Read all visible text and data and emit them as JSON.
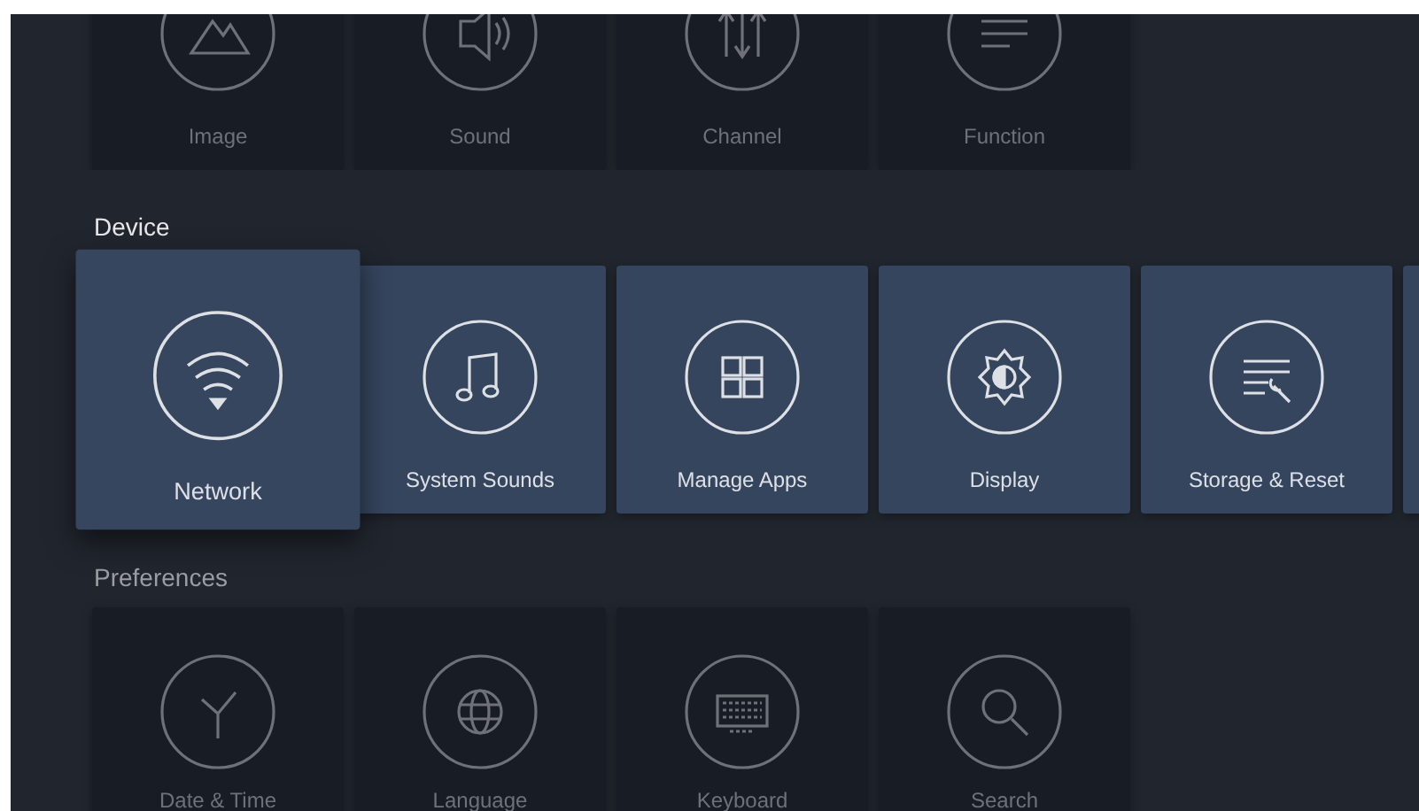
{
  "sections": [
    {
      "active": false,
      "items": [
        {
          "label": "Image",
          "kind": "image",
          "selected": false
        },
        {
          "label": "Sound",
          "kind": "sound",
          "selected": false
        },
        {
          "label": "Channel",
          "kind": "channel",
          "selected": false
        },
        {
          "label": "Function",
          "kind": "function",
          "selected": false
        }
      ]
    },
    {
      "title": "Device",
      "active": true,
      "items": [
        {
          "label": "Network",
          "kind": "network",
          "selected": true
        },
        {
          "label": "System Sounds",
          "kind": "music",
          "selected": false
        },
        {
          "label": "Manage Apps",
          "kind": "apps",
          "selected": false
        },
        {
          "label": "Display",
          "kind": "display",
          "selected": false
        },
        {
          "label": "Storage & Reset",
          "kind": "storage",
          "selected": false
        },
        {
          "kind": "blank",
          "selected": false
        }
      ]
    },
    {
      "title": "Preferences",
      "active": false,
      "items": [
        {
          "label": "Date & Time",
          "kind": "clock",
          "selected": false
        },
        {
          "label": "Language",
          "kind": "globe",
          "selected": false
        },
        {
          "label": "Keyboard",
          "kind": "keyboard",
          "selected": false
        },
        {
          "label": "Search",
          "kind": "search",
          "selected": false
        }
      ]
    }
  ]
}
